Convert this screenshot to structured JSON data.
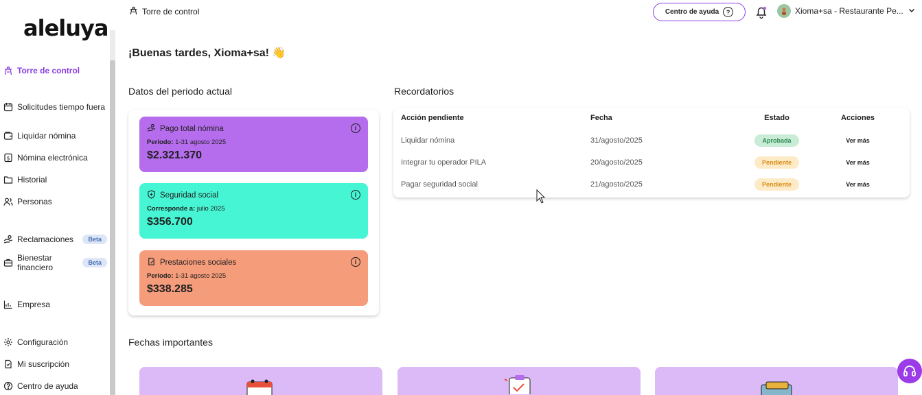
{
  "app": {
    "logo": "aleluya",
    "page_title": "Torre de control"
  },
  "sidebar": {
    "items": [
      {
        "label": "Torre de control",
        "icon": "tower-icon",
        "active": true
      },
      {
        "label": "Solicitudes tiempo fuera",
        "icon": "calendar-icon"
      },
      {
        "label": "Liquidar nómina",
        "icon": "wallet-icon"
      },
      {
        "label": "Nómina electrónica",
        "icon": "dollar-doc-icon"
      },
      {
        "label": "Historial",
        "icon": "folder-icon"
      },
      {
        "label": "Personas",
        "icon": "users-icon"
      },
      {
        "label": "Reclamaciones",
        "icon": "hand-money-icon",
        "badge": "Beta"
      },
      {
        "label": "Bienestar financiero",
        "icon": "briefcase-icon",
        "badge": "Beta"
      },
      {
        "label": "Empresa",
        "icon": "chart-icon"
      },
      {
        "label": "Configuración",
        "icon": "gear-icon"
      },
      {
        "label": "Mi suscripción",
        "icon": "document-icon"
      },
      {
        "label": "Centro de ayuda",
        "icon": "help-icon"
      }
    ]
  },
  "topbar": {
    "help_button": "Centro de ayuda",
    "user_name": "Xioma+sa - Restaurante Pe..."
  },
  "main": {
    "greeting": "¡Buenas tardes, Xioma+sa! 👋",
    "period_title": "Datos del periodo actual",
    "cards": [
      {
        "title": "Pago total nómina",
        "period_label": "Periodo:",
        "period_value": " 1-31 agosto 2025",
        "amount": "$2.321.370",
        "color": "#b56ded"
      },
      {
        "title": "Seguridad social",
        "period_label": "Corresponde a:",
        "period_value": " julio 2025",
        "amount": "$356.700",
        "color": "#46f5d3"
      },
      {
        "title": "Prestaciones sociales",
        "period_label": "Periodo:",
        "period_value": " 1-31 agosto 2025",
        "amount": "$338.285",
        "color": "#f59c7b"
      }
    ],
    "reminders_title": "Recordatorios",
    "table": {
      "headers": [
        "Acción pendiente",
        "Fecha",
        "Estado",
        "Acciones"
      ],
      "rows": [
        {
          "action": "Liquidar nómina",
          "date": "31/agosto/2025",
          "status": "Aprobada",
          "link": "Ver más"
        },
        {
          "action": "Integrar tu operador PILA",
          "date": "20/agosto/2025",
          "status": "Pendiente",
          "link": "Ver más"
        },
        {
          "action": "Pagar seguridad social",
          "date": "21/agosto/2025",
          "status": "Pendiente",
          "link": "Ver más"
        }
      ]
    },
    "important_title": "Fechas importantes"
  },
  "colors": {
    "accent": "#8a3ee0",
    "approved": "#2e8a52",
    "pending": "#d88a12"
  }
}
